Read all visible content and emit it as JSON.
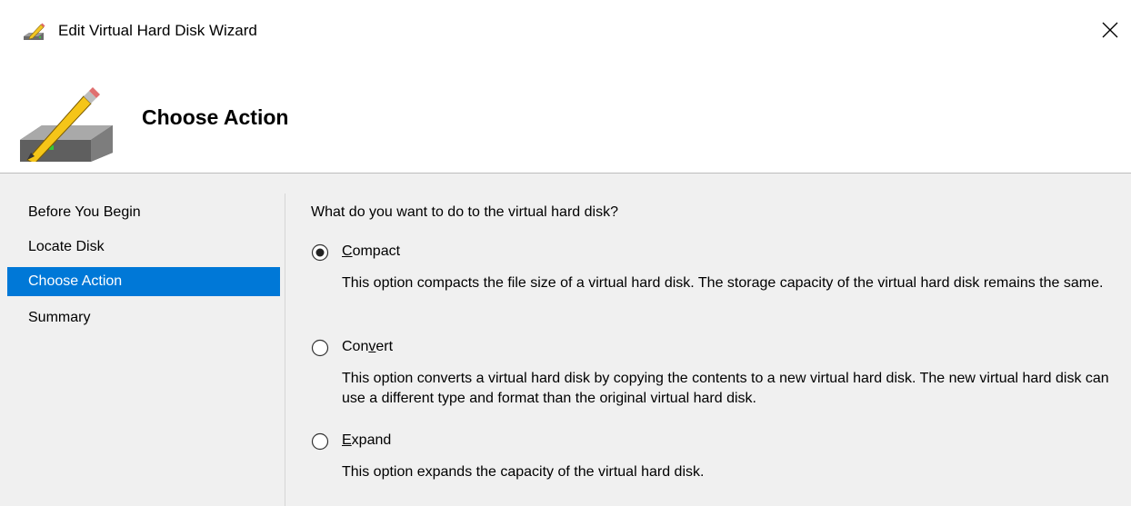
{
  "window": {
    "title": "Edit Virtual Hard Disk Wizard"
  },
  "header": {
    "title": "Choose Action"
  },
  "sidebar": {
    "items": [
      {
        "label": "Before You Begin",
        "active": false
      },
      {
        "label": "Locate Disk",
        "active": false
      },
      {
        "label": "Choose Action",
        "active": true
      },
      {
        "label": "Summary",
        "active": false
      }
    ]
  },
  "main": {
    "question": "What do you want to do to the virtual hard disk?",
    "options": [
      {
        "pre": "",
        "accel": "C",
        "post": "ompact",
        "selected": true,
        "description": "This option compacts the file size of a virtual hard disk. The storage capacity of the virtual hard disk remains the same."
      },
      {
        "pre": "Con",
        "accel": "v",
        "post": "ert",
        "selected": false,
        "description": "This option converts a virtual hard disk by copying the contents to a new virtual hard disk. The new virtual hard disk can use a different type and format than the original virtual hard disk."
      },
      {
        "pre": "",
        "accel": "E",
        "post": "xpand",
        "selected": false,
        "description": "This option expands the capacity of the virtual hard disk."
      }
    ]
  },
  "colors": {
    "accent": "#0078d7",
    "window_bg": "#f0f0f0",
    "header_bg": "#ffffff"
  },
  "icons": {
    "title": "edit-disk-icon",
    "header": "disk-pencil-icon",
    "close": "close-icon"
  }
}
